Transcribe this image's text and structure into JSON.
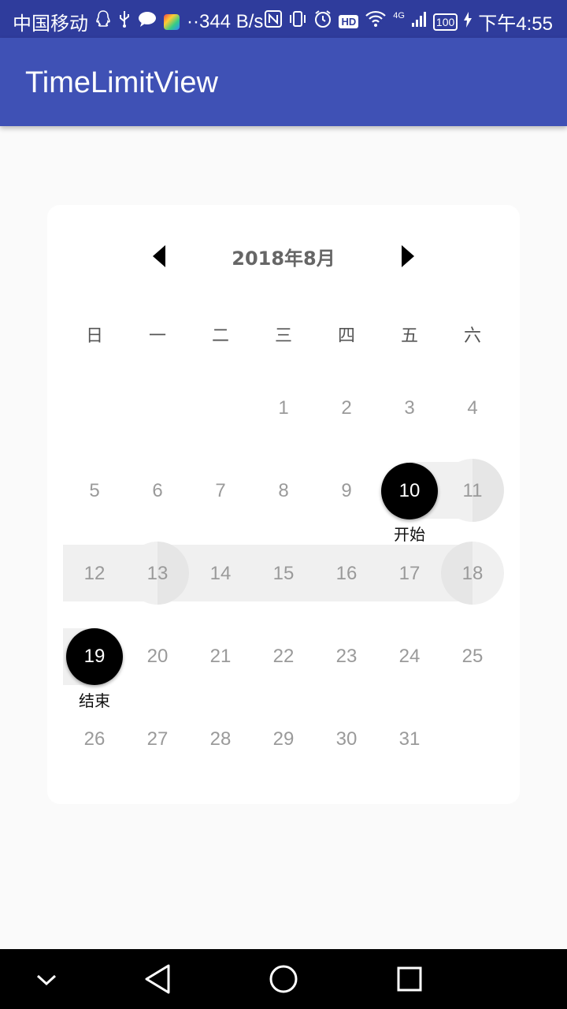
{
  "status_bar": {
    "carrier": "中国移动",
    "network_speed": "··344 B/s",
    "hd_badge": "HD",
    "network_type": "4G",
    "battery": "100",
    "time": "下午4:55"
  },
  "app_bar": {
    "title": "TimeLimitView"
  },
  "calendar": {
    "month_title": "2018年8月",
    "weekdays": [
      "日",
      "一",
      "二",
      "三",
      "四",
      "五",
      "六"
    ],
    "days": [
      "1",
      "2",
      "3",
      "4",
      "5",
      "6",
      "7",
      "8",
      "9",
      "10",
      "11",
      "12",
      "13",
      "14",
      "15",
      "16",
      "17",
      "18",
      "19",
      "20",
      "21",
      "22",
      "23",
      "24",
      "25",
      "26",
      "27",
      "28",
      "29",
      "30",
      "31"
    ],
    "range_start": {
      "day": "10",
      "label": "开始"
    },
    "range_end": {
      "day": "19",
      "label": "结束"
    }
  },
  "colors": {
    "app_bar": "#3f51b5",
    "status_bar": "#2f3c9c",
    "selected": "#000000",
    "range_band": "#f0f0f0",
    "range_cap": "#e6e6e6",
    "day_text": "#9a9a9a"
  }
}
